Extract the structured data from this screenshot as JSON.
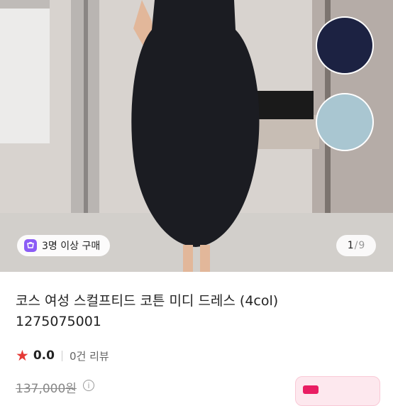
{
  "group_buy_badge": "3명 이상 구매",
  "pager": {
    "current": "1",
    "separator": "/",
    "total": "9"
  },
  "product": {
    "title": "코스 여성 스컬프티드 코튼 미디 드레스 (4col)",
    "code": "1275075001",
    "rating": "0.0",
    "reviews": "0건 리뷰",
    "original_price": "137,000원"
  },
  "colors": {
    "swatch_navy": "#1c2242",
    "swatch_light_blue": "#a9c6d1",
    "accent": "#e53935",
    "badge_purple": "#8b5cf6"
  },
  "icons": {
    "rating": "star-icon",
    "badge": "cart-icon",
    "price_info": "info-icon"
  }
}
